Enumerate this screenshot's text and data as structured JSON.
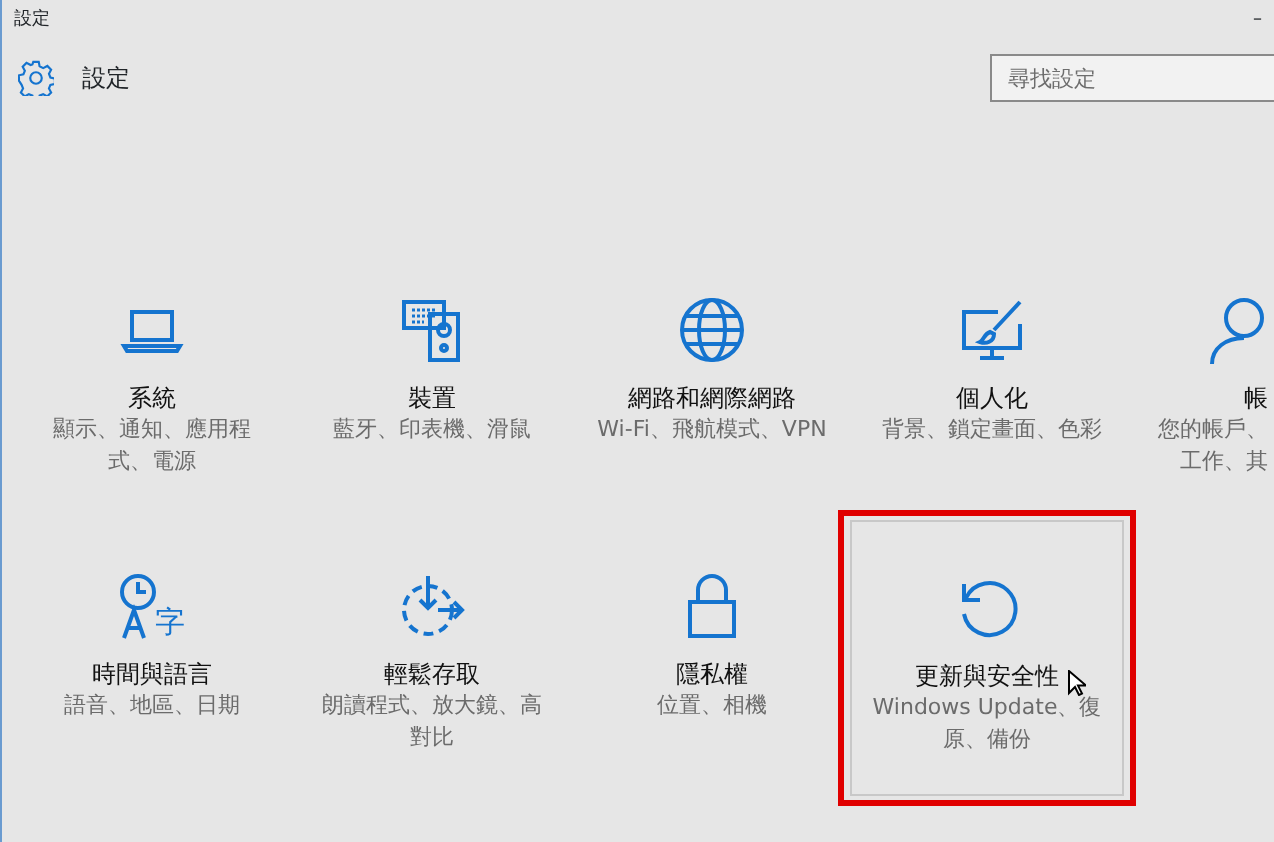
{
  "window": {
    "title": "設定",
    "minimize": "–"
  },
  "header": {
    "title": "設定"
  },
  "search": {
    "placeholder": "尋找設定"
  },
  "rows": [
    [
      {
        "kind": "laptop",
        "title": "系統",
        "description_lines": [
          "顯示、通知、應用程",
          "式、電源"
        ],
        "highlighted": false
      },
      {
        "kind": "devices",
        "title": "裝置",
        "description_lines": [
          "藍牙、印表機、滑鼠"
        ],
        "highlighted": false
      },
      {
        "kind": "globe",
        "title": "網路和網際網路",
        "description_lines": [
          "Wi-Fi、飛航模式、VPN"
        ],
        "highlighted": false
      },
      {
        "kind": "personalize",
        "title": "個人化",
        "description_lines": [
          "背景、鎖定畫面、色彩"
        ],
        "highlighted": false
      },
      {
        "kind": "person",
        "title": "帳",
        "description_lines": [
          "您的帳戶、",
          "工作、其"
        ],
        "highlighted": false
      }
    ],
    [
      {
        "kind": "time-language",
        "glyph": "字",
        "title": "時間與語言",
        "description_lines": [
          "語音、地區、日期"
        ],
        "highlighted": false
      },
      {
        "kind": "ease",
        "title": "輕鬆存取",
        "description_lines": [
          "朗讀程式、放大鏡、高",
          "對比"
        ],
        "highlighted": false
      },
      {
        "kind": "lock",
        "title": "隱私權",
        "description_lines": [
          "位置、相機"
        ],
        "highlighted": false
      },
      {
        "kind": "update",
        "title": "更新與安全性",
        "description_lines": [
          "Windows Update、復",
          "原、備份"
        ],
        "highlighted": true
      }
    ]
  ]
}
